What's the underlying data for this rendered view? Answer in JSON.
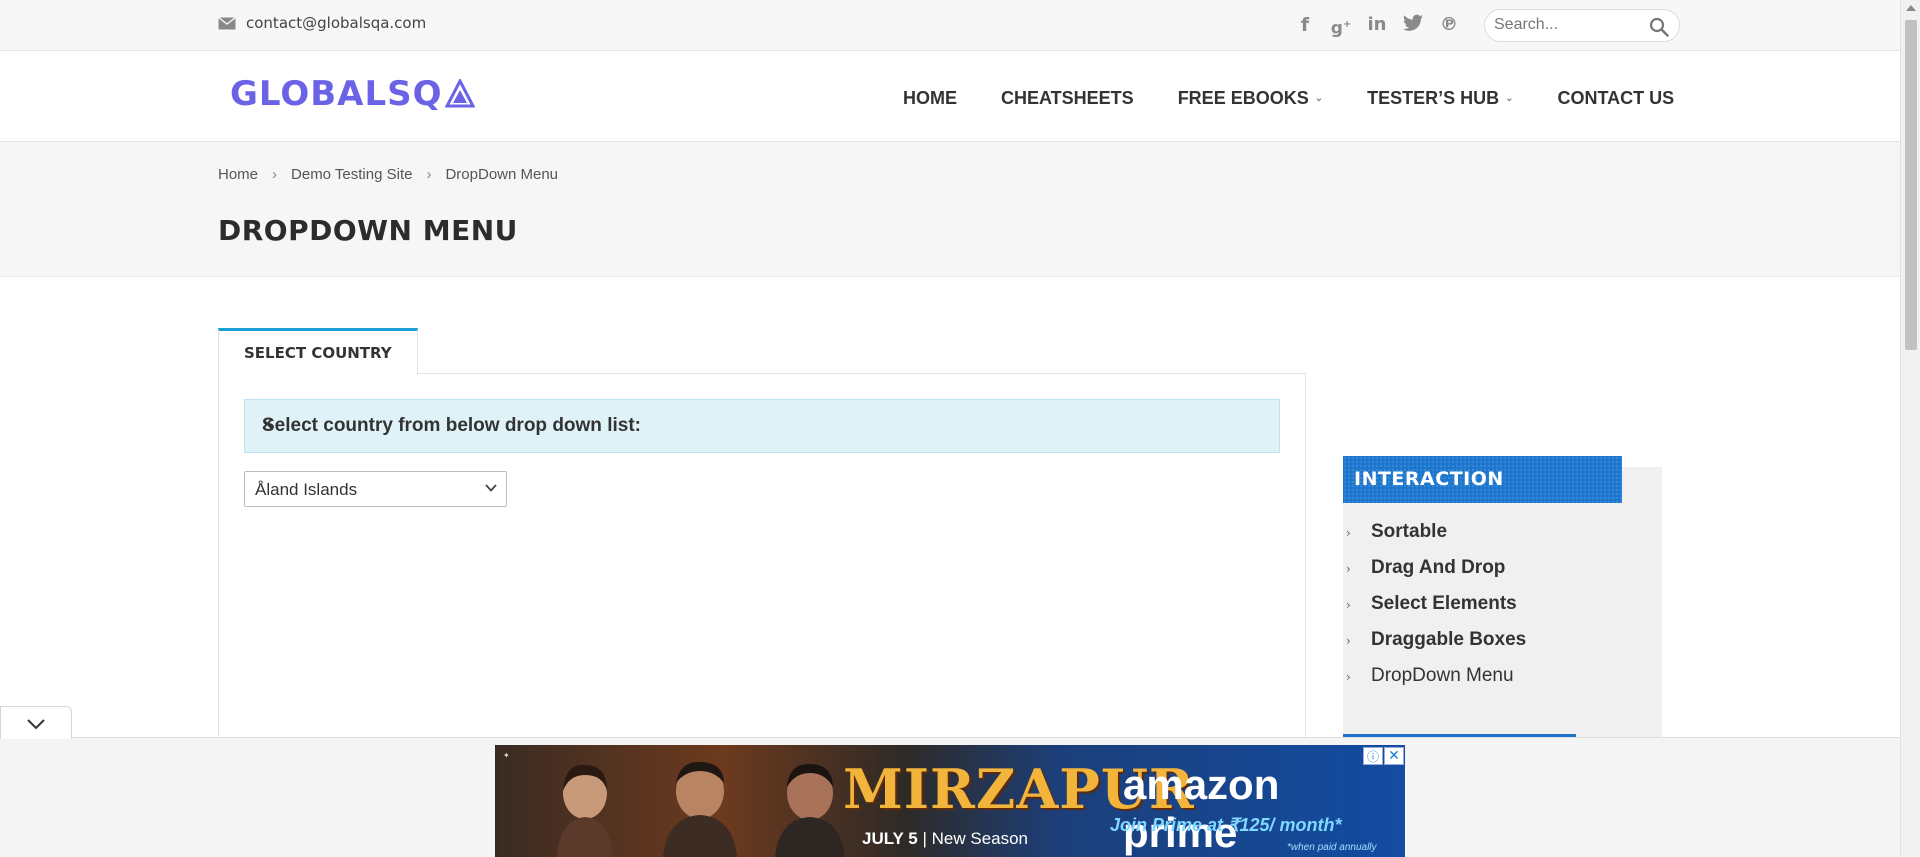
{
  "topbar": {
    "email": "contact@globalsqa.com",
    "search_placeholder": "Search...",
    "social_icons": [
      "facebook-icon",
      "google-plus-icon",
      "linkedin-icon",
      "twitter-icon",
      "pinterest-icon"
    ]
  },
  "header": {
    "logo_text": "GLOBALSQ",
    "nav": [
      {
        "label": "HOME"
      },
      {
        "label": "CHEATSHEETS"
      },
      {
        "label": "FREE EBOOKS"
      },
      {
        "label": "TESTER’S HUB"
      },
      {
        "label": "CONTACT US"
      }
    ]
  },
  "breadcrumb": [
    "Home",
    "Demo Testing Site",
    "DropDown Menu"
  ],
  "page_title": "DROPDOWN MENU",
  "tab": {
    "label": "SELECT COUNTRY"
  },
  "alert": {
    "text": "Select country from below drop down list:",
    "close": "×"
  },
  "country_select": {
    "value": "Åland Islands"
  },
  "sidebar": {
    "heading": "INTERACTION",
    "items": [
      {
        "label": "Sortable"
      },
      {
        "label": "Drag And Drop"
      },
      {
        "label": "Select Elements"
      },
      {
        "label": "Draggable Boxes"
      },
      {
        "label": "DropDown Menu"
      }
    ]
  },
  "ad": {
    "title": "MIRZAPUR",
    "date_bold": "JULY 5",
    "date_rest": " | New Season",
    "brand": "amazon prime",
    "offer": "Join Prime at ₹125/ month*",
    "fine_print": "*when paid annually",
    "adchoices": "ⓘ",
    "close": "✕"
  },
  "colors": {
    "accent": "#1a9fd7",
    "logo": "#6b63e6",
    "sidebar_head": "#1f74c9",
    "alert_bg": "#dff2f7"
  }
}
